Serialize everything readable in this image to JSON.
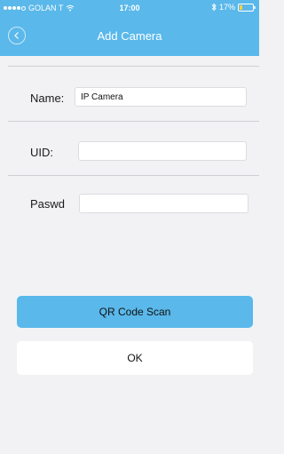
{
  "status_bar": {
    "carrier": "GOLAN T",
    "time": "17:00",
    "battery": "17%",
    "signal_icon": "signal-dots-icon",
    "wifi_icon": "wifi-icon",
    "bluetooth_icon": "bluetooth-icon",
    "battery_icon": "battery-icon"
  },
  "nav": {
    "title": "Add Camera",
    "back_icon": "chevron-left-icon"
  },
  "form": {
    "name": {
      "label": "Name:",
      "value": "IP Camera"
    },
    "uid": {
      "label": "UID:",
      "value": ""
    },
    "password": {
      "label": "Paswd",
      "value": ""
    }
  },
  "buttons": {
    "qr_scan": "QR Code Scan",
    "ok": "OK"
  },
  "colors": {
    "accent": "#5ab8ea",
    "background": "#f2f2f4",
    "battery_low": "#f7d23e"
  }
}
